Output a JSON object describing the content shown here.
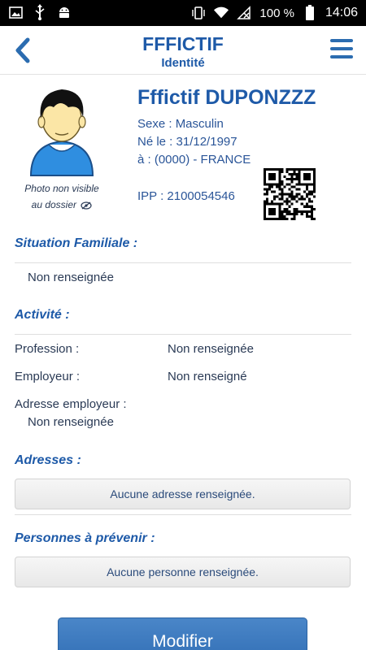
{
  "status_bar": {
    "battery": "100 %",
    "time": "14:06",
    "icons_left": [
      "image-icon",
      "usb-icon",
      "android-icon"
    ],
    "icons_right": [
      "vibrate-icon",
      "wifi-icon",
      "no-signal-icon",
      "battery-icon"
    ]
  },
  "header": {
    "title": "FFFICTIF",
    "subtitle": "Identité"
  },
  "identity": {
    "photo_note_line1": "Photo non visible",
    "photo_note_line2": "au dossier",
    "name": "Fffictif DUPONZZZ",
    "sexe": "Sexe : Masculin",
    "ne_le": "Né le : 31/12/1997",
    "lieu": "à : (0000) - FRANCE",
    "ipp": "IPP : 2100054546"
  },
  "situation": {
    "title": "Situation Familiale :",
    "value": "Non renseignée"
  },
  "activite": {
    "title": "Activité :",
    "profession_label": "Profession :",
    "profession_value": "Non renseignée",
    "employeur_label": "Employeur :",
    "employeur_value": "Non renseigné",
    "adresse_label": "Adresse employeur :",
    "adresse_value": "Non renseignée"
  },
  "adresses": {
    "title": "Adresses :",
    "empty": "Aucune adresse renseignée."
  },
  "personnes": {
    "title": "Personnes à prévenir :",
    "empty": "Aucune personne renseignée."
  },
  "actions": {
    "modify_label": "Modifier"
  },
  "colors": {
    "brand_blue": "#1e5aa8",
    "button_blue": "#3d7cc2"
  }
}
